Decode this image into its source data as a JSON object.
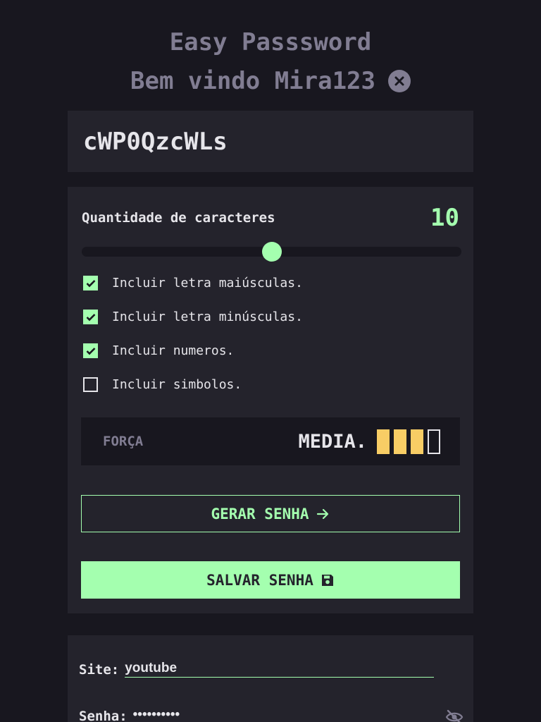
{
  "header": {
    "title": "Easy Passsword",
    "welcome": "Bem vindo Mira123"
  },
  "password": {
    "value": "cWP0QzcWLs"
  },
  "generator": {
    "length_label": "Quantidade de caracteres",
    "length_value": "10",
    "slider_fraction": 0.5,
    "options": [
      {
        "label": "Incluir letra maiúsculas.",
        "checked": true
      },
      {
        "label": "Incluir letra minúsculas.",
        "checked": true
      },
      {
        "label": "Incluir numeros.",
        "checked": true
      },
      {
        "label": "Incluir simbolos.",
        "checked": false
      }
    ],
    "strength": {
      "label": "FORÇA",
      "value": "MEDIA.",
      "filled_bars": 3,
      "total_bars": 4,
      "bar_color": "#f8cd65"
    },
    "generate_label": "GERAR SENHA",
    "save_label": "SALVAR SENHA"
  },
  "save_form": {
    "site_label": "Site:",
    "site_value": "youtube",
    "password_label": "Senha:",
    "password_value": "••••••••••"
  },
  "colors": {
    "accent": "#a4ffaf",
    "background": "#18171f",
    "panel": "#24232c",
    "muted": "#817d92",
    "warning": "#f8cd65"
  },
  "icons": {
    "close": "close-icon",
    "generate": "arrow-right-icon",
    "save": "floppy-disk-icon",
    "visibility": "eye-slash-icon"
  }
}
